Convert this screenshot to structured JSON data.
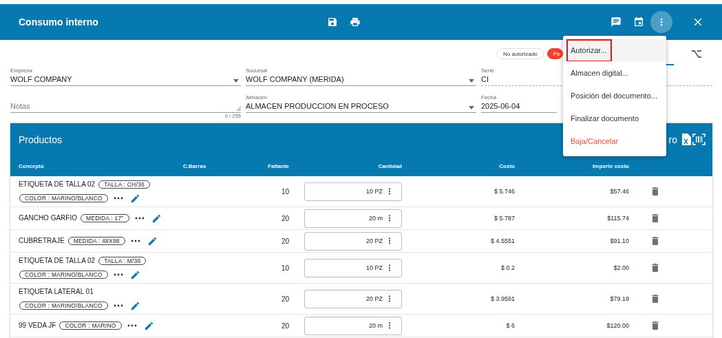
{
  "header": {
    "title": "Consumo interno"
  },
  "status_chips": [
    {
      "label": "No autorizado",
      "kind": "outline"
    },
    {
      "label": "Pe",
      "kind": "alert"
    }
  ],
  "fields": [
    {
      "label": "Empresa",
      "value": "WOLF COMPANY",
      "kind": "select",
      "disabled": false
    },
    {
      "label": "Sucursal",
      "value": "WOLF COMPANY (MERIDA)",
      "kind": "select",
      "disabled": false
    },
    {
      "label": "Serie",
      "value": "CI",
      "kind": "text",
      "disabled": true
    },
    {
      "placeholder": "Notas",
      "counter": "0 / 255",
      "kind": "textarea",
      "disabled": false
    },
    {
      "label": "Almacen",
      "value": "ALMACEN PRODUCCION EN PROCESO",
      "kind": "select",
      "disabled": false
    },
    {
      "label": "Fecha",
      "value": "2025-06-04",
      "kind": "text",
      "disabled": false
    }
  ],
  "products": {
    "title": "Productos",
    "toolbar_text": "ro",
    "columns": [
      "Concepto",
      "C.Barras",
      "Faltante",
      "Cantidad",
      "Costo",
      "Importe costo"
    ],
    "rows": [
      {
        "concept": "ETIQUETA DE TALLA 02",
        "tags": [
          "TALLA : CH/36",
          "COLOR : MARINO/BLANCO"
        ],
        "missing": "10",
        "quantity": "10 PZ",
        "cost": "$ 5.746",
        "amount": "$57.46"
      },
      {
        "concept": "GANCHO GARFIO",
        "tags": [
          "MEDIDA : 17\""
        ],
        "missing": "20",
        "quantity": "20 m",
        "cost": "$ 5.787",
        "amount": "$115.74"
      },
      {
        "concept": "CUBRETRAJE",
        "tags": [
          "MEDIDA : 48X98"
        ],
        "missing": "20",
        "quantity": "20 PZ",
        "cost": "$ 4.5551",
        "amount": "$91.10"
      },
      {
        "concept": "ETIQUETA DE TALLA 02",
        "tags": [
          "TALLA : M/38",
          "COLOR : MARINO/BLANCO"
        ],
        "missing": "10",
        "quantity": "10 PZ",
        "cost": "$ 0.2",
        "amount": "$2.00"
      },
      {
        "concept": "ETIQUETA LATERAL 01",
        "tags": [
          "COLOR : MARINO/BLANCO"
        ],
        "missing": "20",
        "quantity": "20 PZ",
        "cost": "$ 3.9591",
        "amount": "$79.18"
      },
      {
        "concept": "99 VEDA JF",
        "tags": [
          "COLOR : MARINO"
        ],
        "missing": "20",
        "quantity": "20 m",
        "cost": "$ 6",
        "amount": "$120.00"
      }
    ]
  },
  "menu": {
    "open": true,
    "items": [
      {
        "label": "Autorizar...",
        "kind": "normal",
        "selected": true
      },
      {
        "label": "Almacen digital...",
        "kind": "normal",
        "selected": false
      },
      {
        "label": "Posición del documento...",
        "kind": "normal",
        "selected": false
      },
      {
        "label": "Finalizar documento",
        "kind": "normal",
        "selected": false
      },
      {
        "label": "Baja/Cancelar",
        "kind": "danger",
        "selected": false
      }
    ]
  }
}
